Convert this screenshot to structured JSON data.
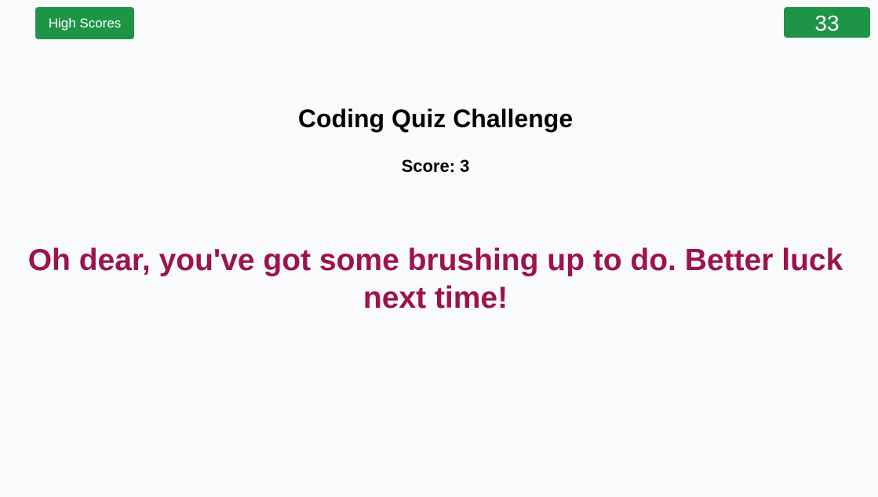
{
  "header": {
    "high_scores_label": "High Scores",
    "timer_value": "33"
  },
  "main": {
    "title": "Coding Quiz Challenge",
    "score_label": "Score: ",
    "score_value": "3",
    "result_message": "Oh dear, you've got some brushing up to do. Better luck next time!"
  },
  "colors": {
    "background": "#f9fafc",
    "button_green": "#1e9447",
    "message_color": "#9d124f"
  }
}
